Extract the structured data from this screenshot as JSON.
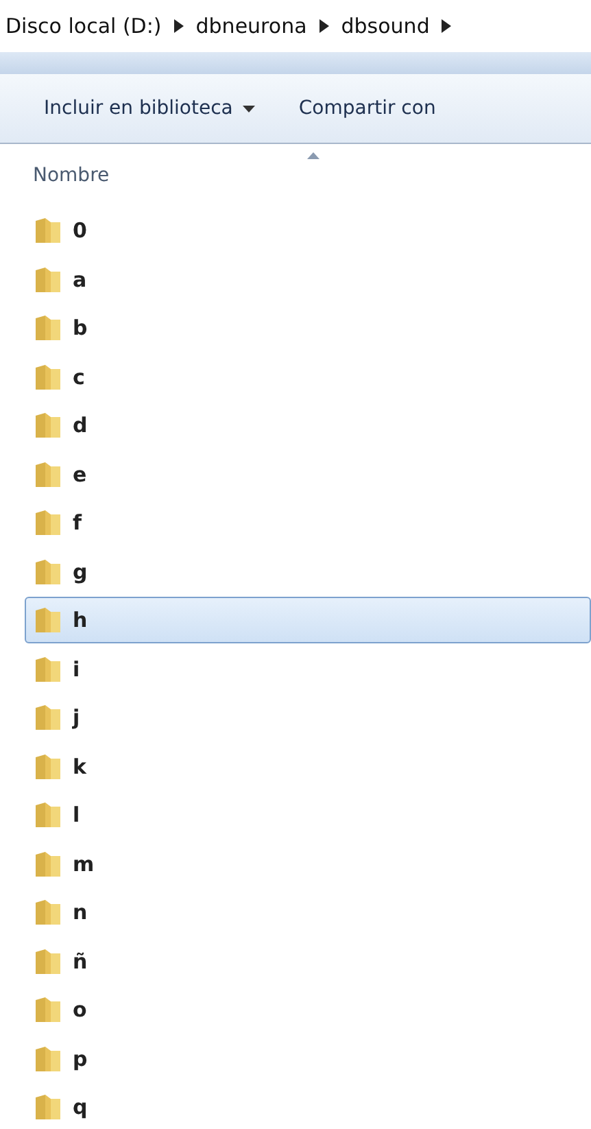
{
  "breadcrumb": [
    "Disco local (D:)",
    "dbneurona",
    "dbsound"
  ],
  "toolbar": [
    {
      "label": "Incluir en biblioteca"
    },
    {
      "label": "Compartir con"
    }
  ],
  "column": {
    "label": "Nombre"
  },
  "folders": [
    {
      "name": "0",
      "selected": false
    },
    {
      "name": "a",
      "selected": false
    },
    {
      "name": "b",
      "selected": false
    },
    {
      "name": "c",
      "selected": false
    },
    {
      "name": "d",
      "selected": false
    },
    {
      "name": "e",
      "selected": false
    },
    {
      "name": "f",
      "selected": false
    },
    {
      "name": "g",
      "selected": false
    },
    {
      "name": "h",
      "selected": true
    },
    {
      "name": "i",
      "selected": false
    },
    {
      "name": "j",
      "selected": false
    },
    {
      "name": "k",
      "selected": false
    },
    {
      "name": "l",
      "selected": false
    },
    {
      "name": "m",
      "selected": false
    },
    {
      "name": "n",
      "selected": false
    },
    {
      "name": "ñ",
      "selected": false
    },
    {
      "name": "o",
      "selected": false
    },
    {
      "name": "p",
      "selected": false
    },
    {
      "name": "q",
      "selected": false
    }
  ]
}
